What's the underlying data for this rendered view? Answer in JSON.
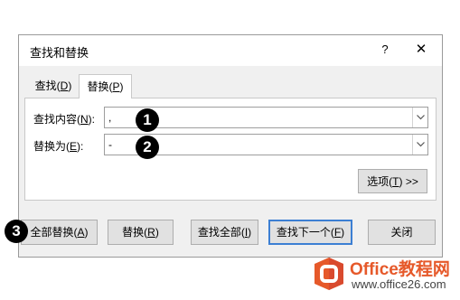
{
  "dialog": {
    "title": "查找和替换",
    "help_label": "?",
    "close_glyph": "✕"
  },
  "tabs": [
    {
      "label": "查找(",
      "key": "D",
      "suffix": ")",
      "active": false
    },
    {
      "label": "替换(",
      "key": "P",
      "suffix": ")",
      "active": true
    }
  ],
  "find": {
    "label": "查找内容(",
    "key": "N",
    "suffix": "):",
    "value": ","
  },
  "replace": {
    "label": "替换为(",
    "key": "E",
    "suffix": "):",
    "value": "-"
  },
  "options_button": {
    "label": "选项(",
    "key": "T",
    "suffix": ") >>"
  },
  "buttons": {
    "replace_all": {
      "label": "全部替换(",
      "key": "A",
      "suffix": ")"
    },
    "replace": {
      "label": "替换(",
      "key": "R",
      "suffix": ")"
    },
    "find_all": {
      "label": "查找全部(",
      "key": "I",
      "suffix": ")"
    },
    "find_next": {
      "label": "查找下一个(",
      "key": "F",
      "suffix": ")"
    },
    "close": {
      "label": "关闭"
    }
  },
  "callouts": [
    "1",
    "2",
    "3"
  ],
  "watermark": {
    "line1": "Office教程网",
    "line2": "www.office26.com"
  },
  "colors": {
    "dialog_bg": "#f0f0f0",
    "default_button_border": "#3c7fd3",
    "watermark_orange": "#e6592a",
    "watermark_red": "#d94a2e"
  }
}
